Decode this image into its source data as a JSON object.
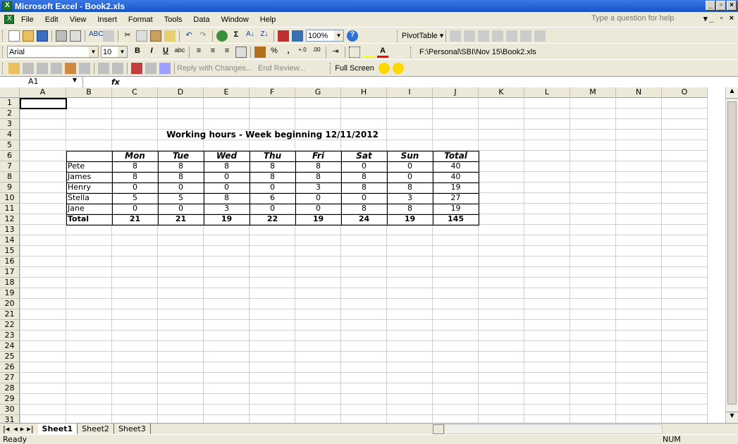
{
  "window": {
    "title": "Microsoft Excel - Book2.xls"
  },
  "menu": [
    "File",
    "Edit",
    "View",
    "Insert",
    "Format",
    "Tools",
    "Data",
    "Window",
    "Help"
  ],
  "question_placeholder": "Type a question for help",
  "toolbar": {
    "zoom": "100%",
    "pivot_label": "PivotTable ▾",
    "font": "Arial",
    "size": "10",
    "path": "F:\\Personal\\SBI\\Nov 15\\Book2.xls",
    "reply_label": "Reply with Changes...",
    "end_review": "End Review...",
    "full_screen": "Full Screen"
  },
  "namebox": "A1",
  "fx": "fx",
  "columns": [
    "A",
    "B",
    "C",
    "D",
    "E",
    "F",
    "G",
    "H",
    "I",
    "J",
    "K",
    "L",
    "M",
    "N",
    "O"
  ],
  "rows": [
    "1",
    "2",
    "3",
    "4",
    "5",
    "6",
    "7",
    "8",
    "9",
    "10",
    "11",
    "12",
    "13",
    "14",
    "15",
    "16",
    "17",
    "18",
    "19",
    "20",
    "21",
    "22",
    "23",
    "24",
    "25",
    "26",
    "27",
    "28",
    "29",
    "30",
    "31"
  ],
  "sheet_title": "Working hours - Week beginning 12/11/2012",
  "headers": [
    "Mon",
    "Tue",
    "Wed",
    "Thu",
    "Fri",
    "Sat",
    "Sun",
    "Total"
  ],
  "table": [
    {
      "name": "Pete",
      "values": [
        "8",
        "8",
        "8",
        "8",
        "8",
        "0",
        "0",
        "40"
      ]
    },
    {
      "name": "James",
      "values": [
        "8",
        "8",
        "0",
        "8",
        "8",
        "8",
        "0",
        "40"
      ]
    },
    {
      "name": "Henry",
      "values": [
        "0",
        "0",
        "0",
        "0",
        "3",
        "8",
        "8",
        "19"
      ]
    },
    {
      "name": "Stella",
      "values": [
        "5",
        "5",
        "8",
        "6",
        "0",
        "0",
        "3",
        "27"
      ]
    },
    {
      "name": "Jane",
      "values": [
        "0",
        "0",
        "3",
        "0",
        "0",
        "8",
        "8",
        "19"
      ]
    }
  ],
  "total_row": {
    "name": "Total",
    "values": [
      "21",
      "21",
      "19",
      "22",
      "19",
      "24",
      "19",
      "145"
    ]
  },
  "sheets": [
    "Sheet1",
    "Sheet2",
    "Sheet3"
  ],
  "status": "Ready",
  "num": "NUM"
}
